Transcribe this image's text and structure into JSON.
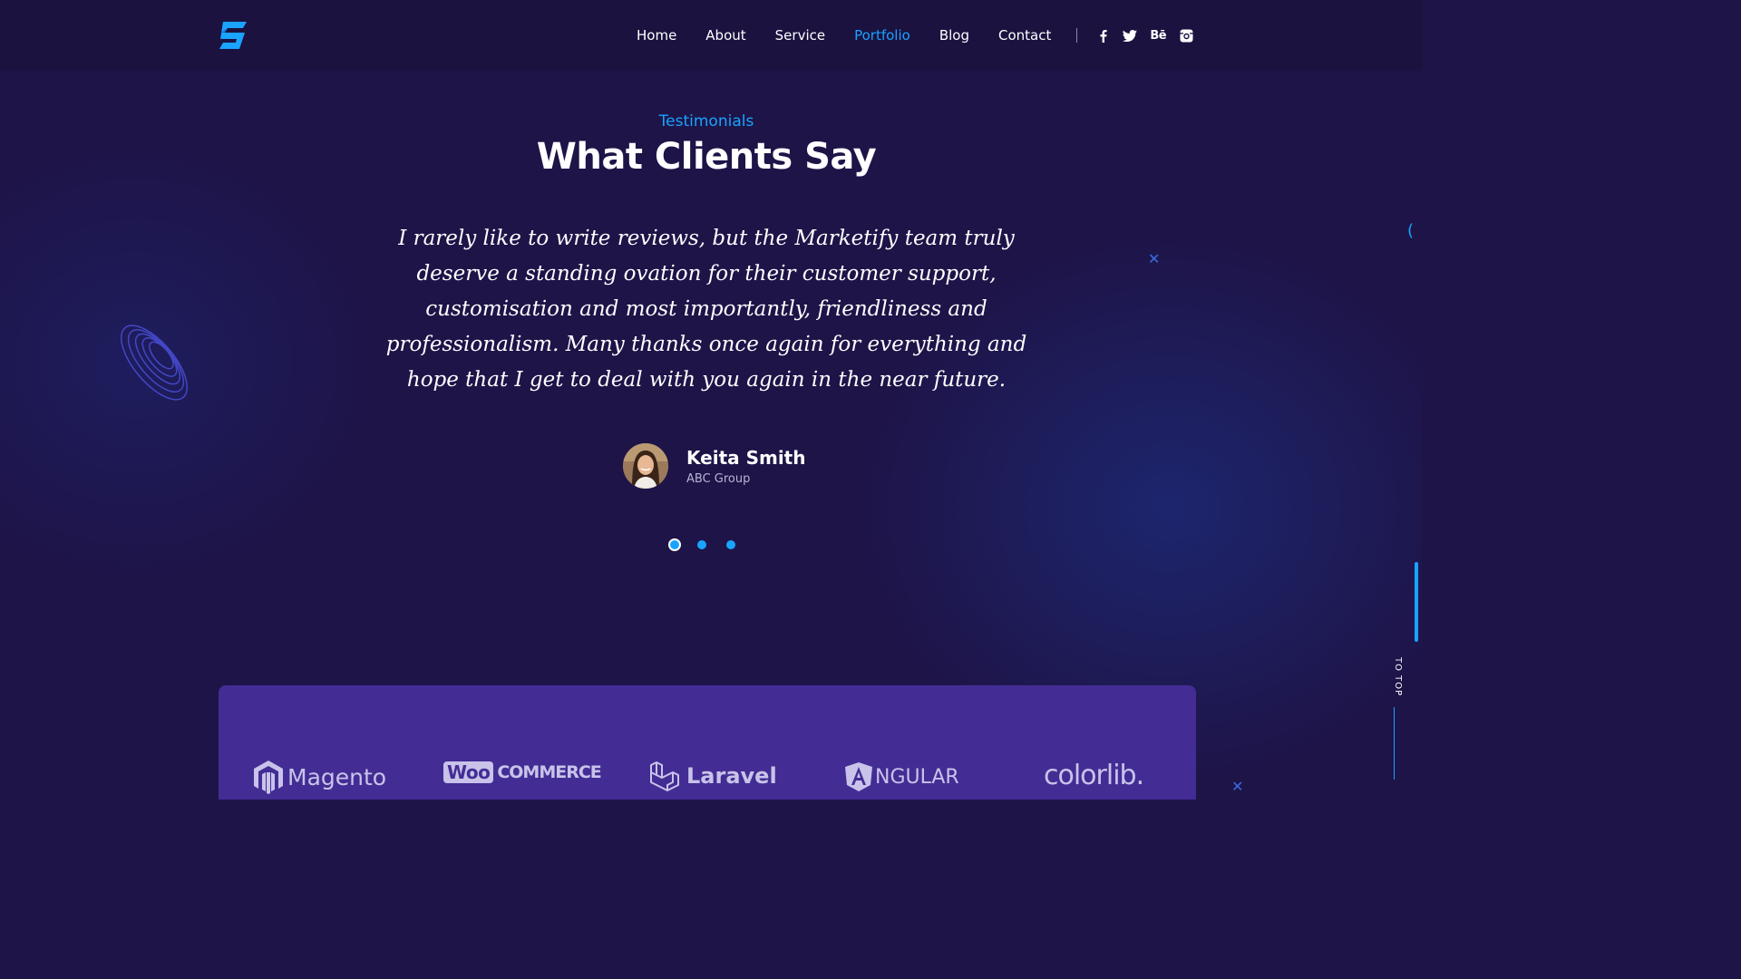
{
  "nav": {
    "items": [
      {
        "label": "Home",
        "active": false
      },
      {
        "label": "About",
        "active": false
      },
      {
        "label": "Service",
        "active": false
      },
      {
        "label": "Portfolio",
        "active": true
      },
      {
        "label": "Blog",
        "active": false
      },
      {
        "label": "Contact",
        "active": false
      }
    ],
    "social": {
      "facebook_icon": "facebook-icon",
      "twitter_icon": "twitter-icon",
      "behance_label": "Bē",
      "instagram_icon": "instagram-icon"
    }
  },
  "testimonials": {
    "eyebrow": "Testimonials",
    "title": "What Clients Say",
    "quote": "I rarely like to write reviews, but the Marketify team truly deserve a standing ovation for their customer support, customisation and most importantly, friendliness and professionalism. Many thanks once again for everything and hope that I get to deal with you again in the near future.",
    "author_name": "Keita Smith",
    "author_company": "ABC Group",
    "slide_count": 3,
    "active_slide": 1
  },
  "side": {
    "to_top": "TO TOP"
  },
  "brands": {
    "magento": "Magento",
    "woo_box": "Woo",
    "woo_text": "COMMERCE",
    "laravel": "Laravel",
    "angular": "NGULAR",
    "colorlib": "colorlib."
  },
  "colors": {
    "background": "#1e1448",
    "accent": "#1aa3ff",
    "brand_panel": "#432d94"
  }
}
